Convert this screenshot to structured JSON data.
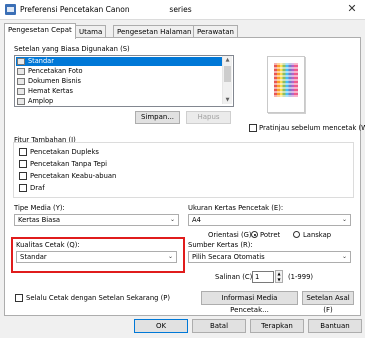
{
  "window": {
    "title_prefix": "Preferensi Pencetakan Canon",
    "title_suffix": "series",
    "close_glyph": "✕"
  },
  "tabs": [
    {
      "label": "Pengesetan Cepat"
    },
    {
      "label": "Utama"
    },
    {
      "label": "Pengesetan Halaman"
    },
    {
      "label": "Perawatan"
    }
  ],
  "presets": {
    "label": "Setelan yang Biasa Digunakan (S)",
    "items": [
      "Standar",
      "Pencetakan Foto",
      "Dokumen Bisnis",
      "Hemat Kertas",
      "Amplop"
    ],
    "selected_index": 0,
    "save_button": "Simpan...",
    "delete_button": "Hapus"
  },
  "preview": {
    "checkbox_label": "Pratinjau sebelum mencetak (W)",
    "checked": false
  },
  "additional": {
    "label": "Fitur Tambahan (I)",
    "options": [
      {
        "label": "Pencetakan Dupleks",
        "checked": false
      },
      {
        "label": "Pencetakan Tanpa Tepi",
        "checked": false
      },
      {
        "label": "Pencetakan Keabu-abuan",
        "checked": false
      },
      {
        "label": "Draf",
        "checked": false
      }
    ]
  },
  "media_type": {
    "label": "Tipe Media (Y):",
    "value": "Kertas Biasa"
  },
  "paper_size": {
    "label": "Ukuran Kertas Pencetak (E):",
    "value": "A4"
  },
  "orientation": {
    "label": "Orientasi (G):",
    "portrait": "Potret",
    "landscape": "Lanskap",
    "selected": "portrait"
  },
  "print_quality": {
    "label": "Kualitas Cetak (Q):",
    "value": "Standar"
  },
  "paper_source": {
    "label": "Sumber Kertas (R):",
    "value": "Pilih Secara Otomatis"
  },
  "copies": {
    "label": "Salinan (C):",
    "value": "1",
    "range": "(1-999)"
  },
  "always_print": {
    "label": "Selalu Cetak dengan Setelan Sekarang (P)",
    "checked": false
  },
  "info_button": "Informasi Media Pencetak...",
  "defaults_button": "Setelan Asal (F)",
  "footer": {
    "ok": "OK",
    "cancel": "Batal",
    "apply": "Terapkan",
    "help": "Bantuan"
  },
  "colors": {
    "selection": "#0078d7",
    "highlight_box": "#e01c1c"
  }
}
